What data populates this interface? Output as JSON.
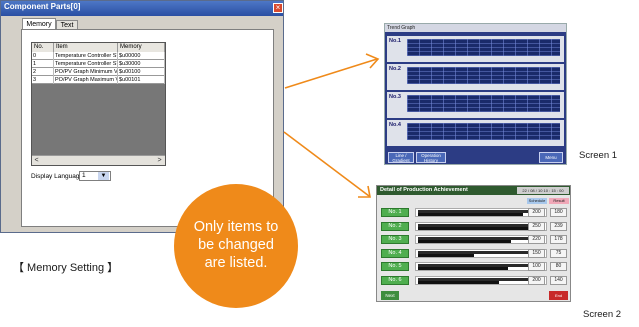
{
  "dialog": {
    "title": "Component Parts[0]",
    "close_glyph": "×",
    "tabs": [
      "Memory",
      "Text"
    ],
    "columns": [
      "No.",
      "Item",
      "Memory"
    ],
    "rows": [
      {
        "no": "0",
        "item": "Temperature Controller ST",
        "memory": "$u00000"
      },
      {
        "no": "1",
        "item": "Temperature Controller ST",
        "memory": "$u30000"
      },
      {
        "no": "2",
        "item": "PO/PV Graph Minimum Valu",
        "memory": "$u00100"
      },
      {
        "no": "3",
        "item": "PO/PV Graph Maximum Valu",
        "memory": "$u00101"
      }
    ],
    "scroll_left": "<",
    "scroll_right": ">",
    "language_label": "Display Language:",
    "language_value": "1",
    "dropdown_glyph": "▼"
  },
  "memory_caption": "【 Memory Setting 】",
  "callout": {
    "line1": "Only items to",
    "line2": "be changed",
    "line3": "are listed.",
    "color": "#ef8a1a"
  },
  "screen1": {
    "caption": "Screen 1",
    "window_title": "Trend Graph",
    "rows": [
      "No.1",
      "No.2",
      "No.3",
      "No.4"
    ],
    "buttons": {
      "b1": "Line / Gradient",
      "b2": "Operation History",
      "b3": "Menu"
    }
  },
  "screen2": {
    "caption": "Screen 2",
    "window_title": "Detail of Production Achievement",
    "time": "22 / 08 / 10 10 : 15 : 00",
    "headers": {
      "schedule": "Schedule",
      "result": "Result"
    },
    "rows": [
      {
        "label": "No. 1",
        "schedule": "200",
        "result": "180",
        "schedule_pct": 0.9,
        "result_pct": 0.82
      },
      {
        "label": "No. 2",
        "schedule": "250",
        "result": "239",
        "schedule_pct": 0.92,
        "result_pct": 0.88
      },
      {
        "label": "No. 3",
        "schedule": "220",
        "result": "178",
        "schedule_pct": 0.9,
        "result_pct": 0.73
      },
      {
        "label": "No. 4",
        "schedule": "150",
        "result": "75",
        "schedule_pct": 0.88,
        "result_pct": 0.44
      },
      {
        "label": "No. 5",
        "schedule": "100",
        "result": "80",
        "schedule_pct": 0.88,
        "result_pct": 0.7
      },
      {
        "label": "No. 6",
        "schedule": "200",
        "result": "140",
        "schedule_pct": 0.9,
        "result_pct": 0.63
      }
    ],
    "next_label": "Next",
    "end_label": "End"
  },
  "arrows_color": "#ef8a1a"
}
